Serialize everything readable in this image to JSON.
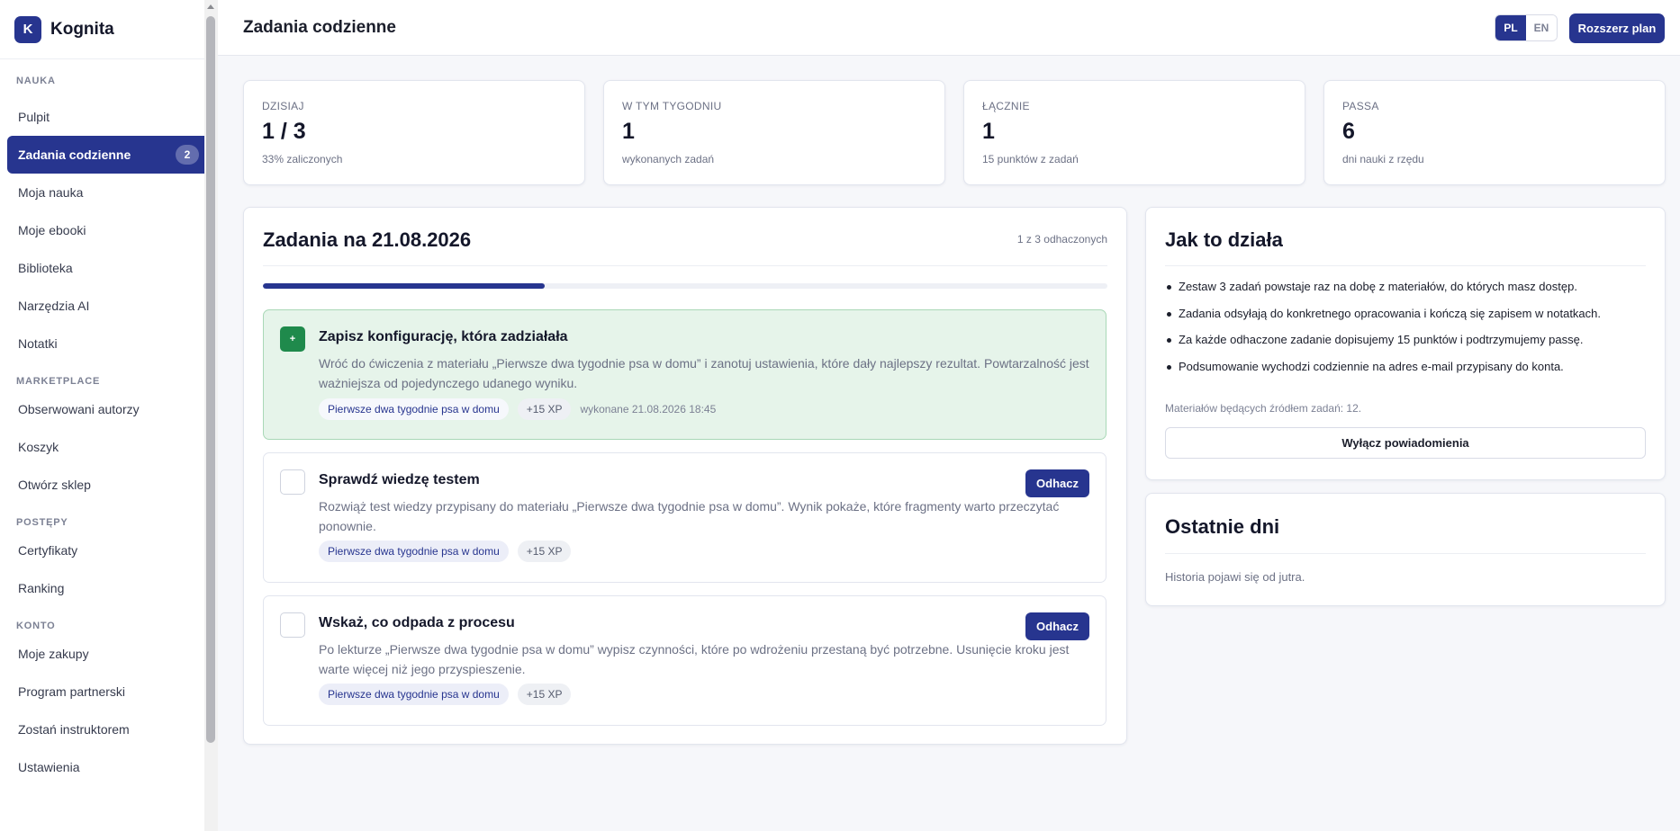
{
  "brand": {
    "logo_letter": "K",
    "name": "Kognita"
  },
  "sidebar": {
    "sections": [
      {
        "title": "NAUKA",
        "items": [
          {
            "label": "Pulpit"
          },
          {
            "label": "Zadania codzienne",
            "badge": "2",
            "active": true
          },
          {
            "label": "Moja nauka"
          },
          {
            "label": "Moje ebooki"
          },
          {
            "label": "Biblioteka"
          },
          {
            "label": "Narzędzia AI"
          },
          {
            "label": "Notatki"
          }
        ]
      },
      {
        "title": "MARKETPLACE",
        "items": [
          {
            "label": "Obserwowani autorzy"
          },
          {
            "label": "Koszyk"
          },
          {
            "label": "Otwórz sklep"
          }
        ]
      },
      {
        "title": "POSTĘPY",
        "items": [
          {
            "label": "Certyfikaty"
          },
          {
            "label": "Ranking"
          }
        ]
      },
      {
        "title": "KONTO",
        "items": [
          {
            "label": "Moje zakupy"
          },
          {
            "label": "Program partnerski"
          },
          {
            "label": "Zostań instruktorem"
          },
          {
            "label": "Ustawienia"
          }
        ]
      }
    ]
  },
  "header": {
    "title": "Zadania codzienne",
    "lang_pl": "PL",
    "lang_en": "EN",
    "active_lang": "PL",
    "upgrade_label": "Rozszerz plan"
  },
  "stats": [
    {
      "label": "DZISIAJ",
      "value": "1 / 3",
      "sub": "33% zaliczonych"
    },
    {
      "label": "W TYM TYGODNIU",
      "value": "1",
      "sub": "wykonanych zadań"
    },
    {
      "label": "ŁĄCZNIE",
      "value": "1",
      "sub": "15 punktów z zadań"
    },
    {
      "label": "PASSA",
      "value": "6",
      "sub": "dni nauki z rzędu"
    }
  ],
  "tasks_panel": {
    "title": "Zadania na 21.08.2026",
    "progress_text": "1 z 3 odhaczonych",
    "progress_fraction": 0.3333,
    "tick_label": "Odhacz",
    "tasks": [
      {
        "done": true,
        "check_glyph": "+",
        "title": "Zapisz konfigurację, która zadziałała",
        "desc": "Wróć do ćwiczenia z materiału „Pierwsze dwa tygodnie psa w domu” i zanotuj ustawienia, które dały najlepszy rezultat. Powtarzalność jest ważniejsza od pojedynczego udanego wyniku.",
        "material": "Pierwsze dwa tygodnie psa w domu",
        "xp": "+15 XP",
        "done_at": "wykonane 21.08.2026 18:45"
      },
      {
        "done": false,
        "title": "Sprawdź wiedzę testem",
        "desc": "Rozwiąż test wiedzy przypisany do materiału „Pierwsze dwa tygodnie psa w domu”. Wynik pokaże, które fragmenty warto przeczytać ponownie.",
        "material": "Pierwsze dwa tygodnie psa w domu",
        "xp": "+15 XP"
      },
      {
        "done": false,
        "title": "Wskaż, co odpada z procesu",
        "desc": "Po lekturze „Pierwsze dwa tygodnie psa w domu” wypisz czynności, które po wdrożeniu przestaną być potrzebne. Usunięcie kroku jest warte więcej niż jego przyspieszenie.",
        "material": "Pierwsze dwa tygodnie psa w domu",
        "xp": "+15 XP"
      }
    ]
  },
  "how_it_works": {
    "title": "Jak to działa",
    "points": [
      "Zestaw 3 zadań powstaje raz na dobę z materiałów, do których masz dostęp.",
      "Zadania odsyłają do konkretnego opracowania i kończą się zapisem w notatkach.",
      "Za każde odhaczone zadanie dopisujemy 15 punktów i podtrzymujemy passę.",
      "Podsumowanie wychodzi codziennie na adres e-mail przypisany do konta."
    ],
    "source_note": "Materiałów będących źródłem zadań: 12.",
    "notif_button": "Wyłącz powiadomienia"
  },
  "recent_days": {
    "title": "Ostatnie dni",
    "empty_note": "Historia pojawi się od jutra."
  },
  "colors": {
    "accent": "#27358f",
    "done_bg": "#e6f4ea",
    "done_check": "#1f8a4c"
  }
}
